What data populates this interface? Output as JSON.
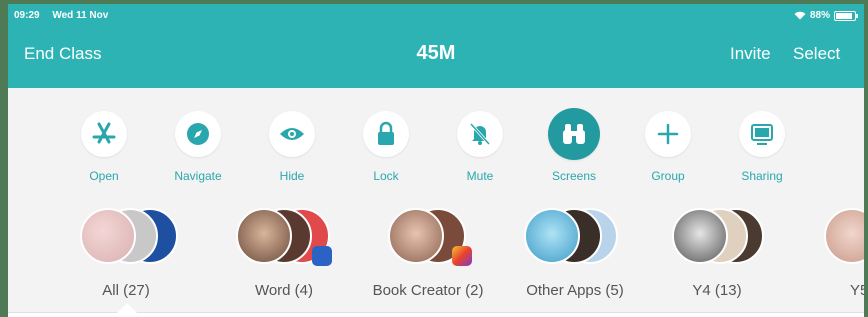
{
  "status_bar": {
    "time": "09:29",
    "date": "Wed 11 Nov",
    "battery": "88%"
  },
  "nav": {
    "left": "End Class",
    "title": "45M",
    "invite": "Invite",
    "select": "Select"
  },
  "tools": [
    {
      "label": "Open",
      "icon": "app-store-icon"
    },
    {
      "label": "Navigate",
      "icon": "compass-icon"
    },
    {
      "label": "Hide",
      "icon": "eye-icon"
    },
    {
      "label": "Lock",
      "icon": "lock-icon"
    },
    {
      "label": "Mute",
      "icon": "bell-slash-icon"
    },
    {
      "label": "Screens",
      "icon": "binoculars-icon"
    },
    {
      "label": "Group",
      "icon": "plus-icon"
    },
    {
      "label": "Sharing",
      "icon": "apple-tv-icon"
    }
  ],
  "groups": [
    {
      "label": "All (27)"
    },
    {
      "label": "Word (4)"
    },
    {
      "label": "Book Creator (2)"
    },
    {
      "label": "Other Apps (5)"
    },
    {
      "label": "Y4 (13)"
    },
    {
      "label": "Y5"
    }
  ],
  "colors": {
    "header": "#2eb3b5",
    "accent": "#2aa7ad",
    "active": "#229aa0",
    "background": "#f3f3f3"
  }
}
